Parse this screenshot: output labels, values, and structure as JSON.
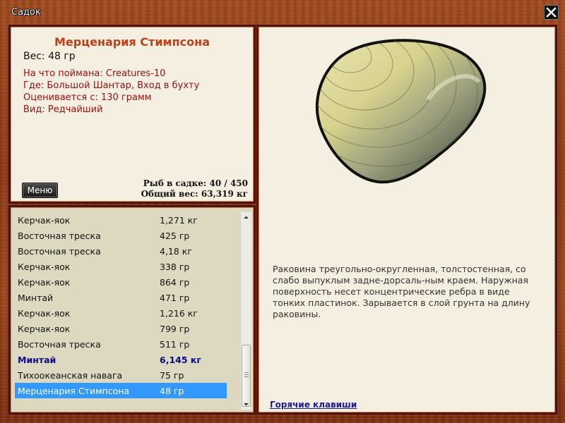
{
  "window": {
    "title": "Садок"
  },
  "fish": {
    "name": "Мерценария Стимпсона",
    "weight": "Вес: 48 гр",
    "caught_on": "На что поймана: Creatures-10",
    "where": "Где: Большой Шантар, Вход в бухту",
    "valued_from": "Оценивается с: 130 грамм",
    "kind": "Вид: Редчайший",
    "description": "Раковина треугольно-округленная, толстостенная, со слабо выпуклым задне-дорсаль-ным краем. Наружная поверхность несет концентрические ребра в виде тонких пластинок. Зарывается в слой грунта на длину раковины."
  },
  "menu_label": "Меню",
  "stats": {
    "fish_count": "Рыб в садке: 40 / 450",
    "total_weight": "Общий вес: 63,319 кг"
  },
  "catch_list": [
    {
      "name": "Керчак-яок",
      "weight": "1,271 кг"
    },
    {
      "name": "Восточная треска",
      "weight": "425 гр"
    },
    {
      "name": "Восточная треска",
      "weight": "4,18 кг"
    },
    {
      "name": "Керчак-яок",
      "weight": "338 гр"
    },
    {
      "name": "Керчак-яок",
      "weight": "864 гр"
    },
    {
      "name": "Минтай",
      "weight": "471 гр"
    },
    {
      "name": "Керчак-яок",
      "weight": "1,216 кг"
    },
    {
      "name": "Керчак-яок",
      "weight": "799 гр"
    },
    {
      "name": "Восточная треска",
      "weight": "511 гр"
    },
    {
      "name": "Минтай",
      "weight": "6,145 кг"
    },
    {
      "name": "Тихоокеанская навага",
      "weight": "75 гр"
    },
    {
      "name": "Мерценария Стимпсона",
      "weight": "48 гр"
    }
  ],
  "hotkeys_label": "Горячие клавиши",
  "icons": {
    "close": "close-icon",
    "scroll_up": "arrow-up-icon",
    "scroll_down": "arrow-down-icon"
  },
  "colors": {
    "fish_name": "#c0401a",
    "info_text": "#a01010",
    "highlight_row": "#0a0a8a",
    "selected_row": "#3399ff",
    "link": "#1a1aa0"
  }
}
